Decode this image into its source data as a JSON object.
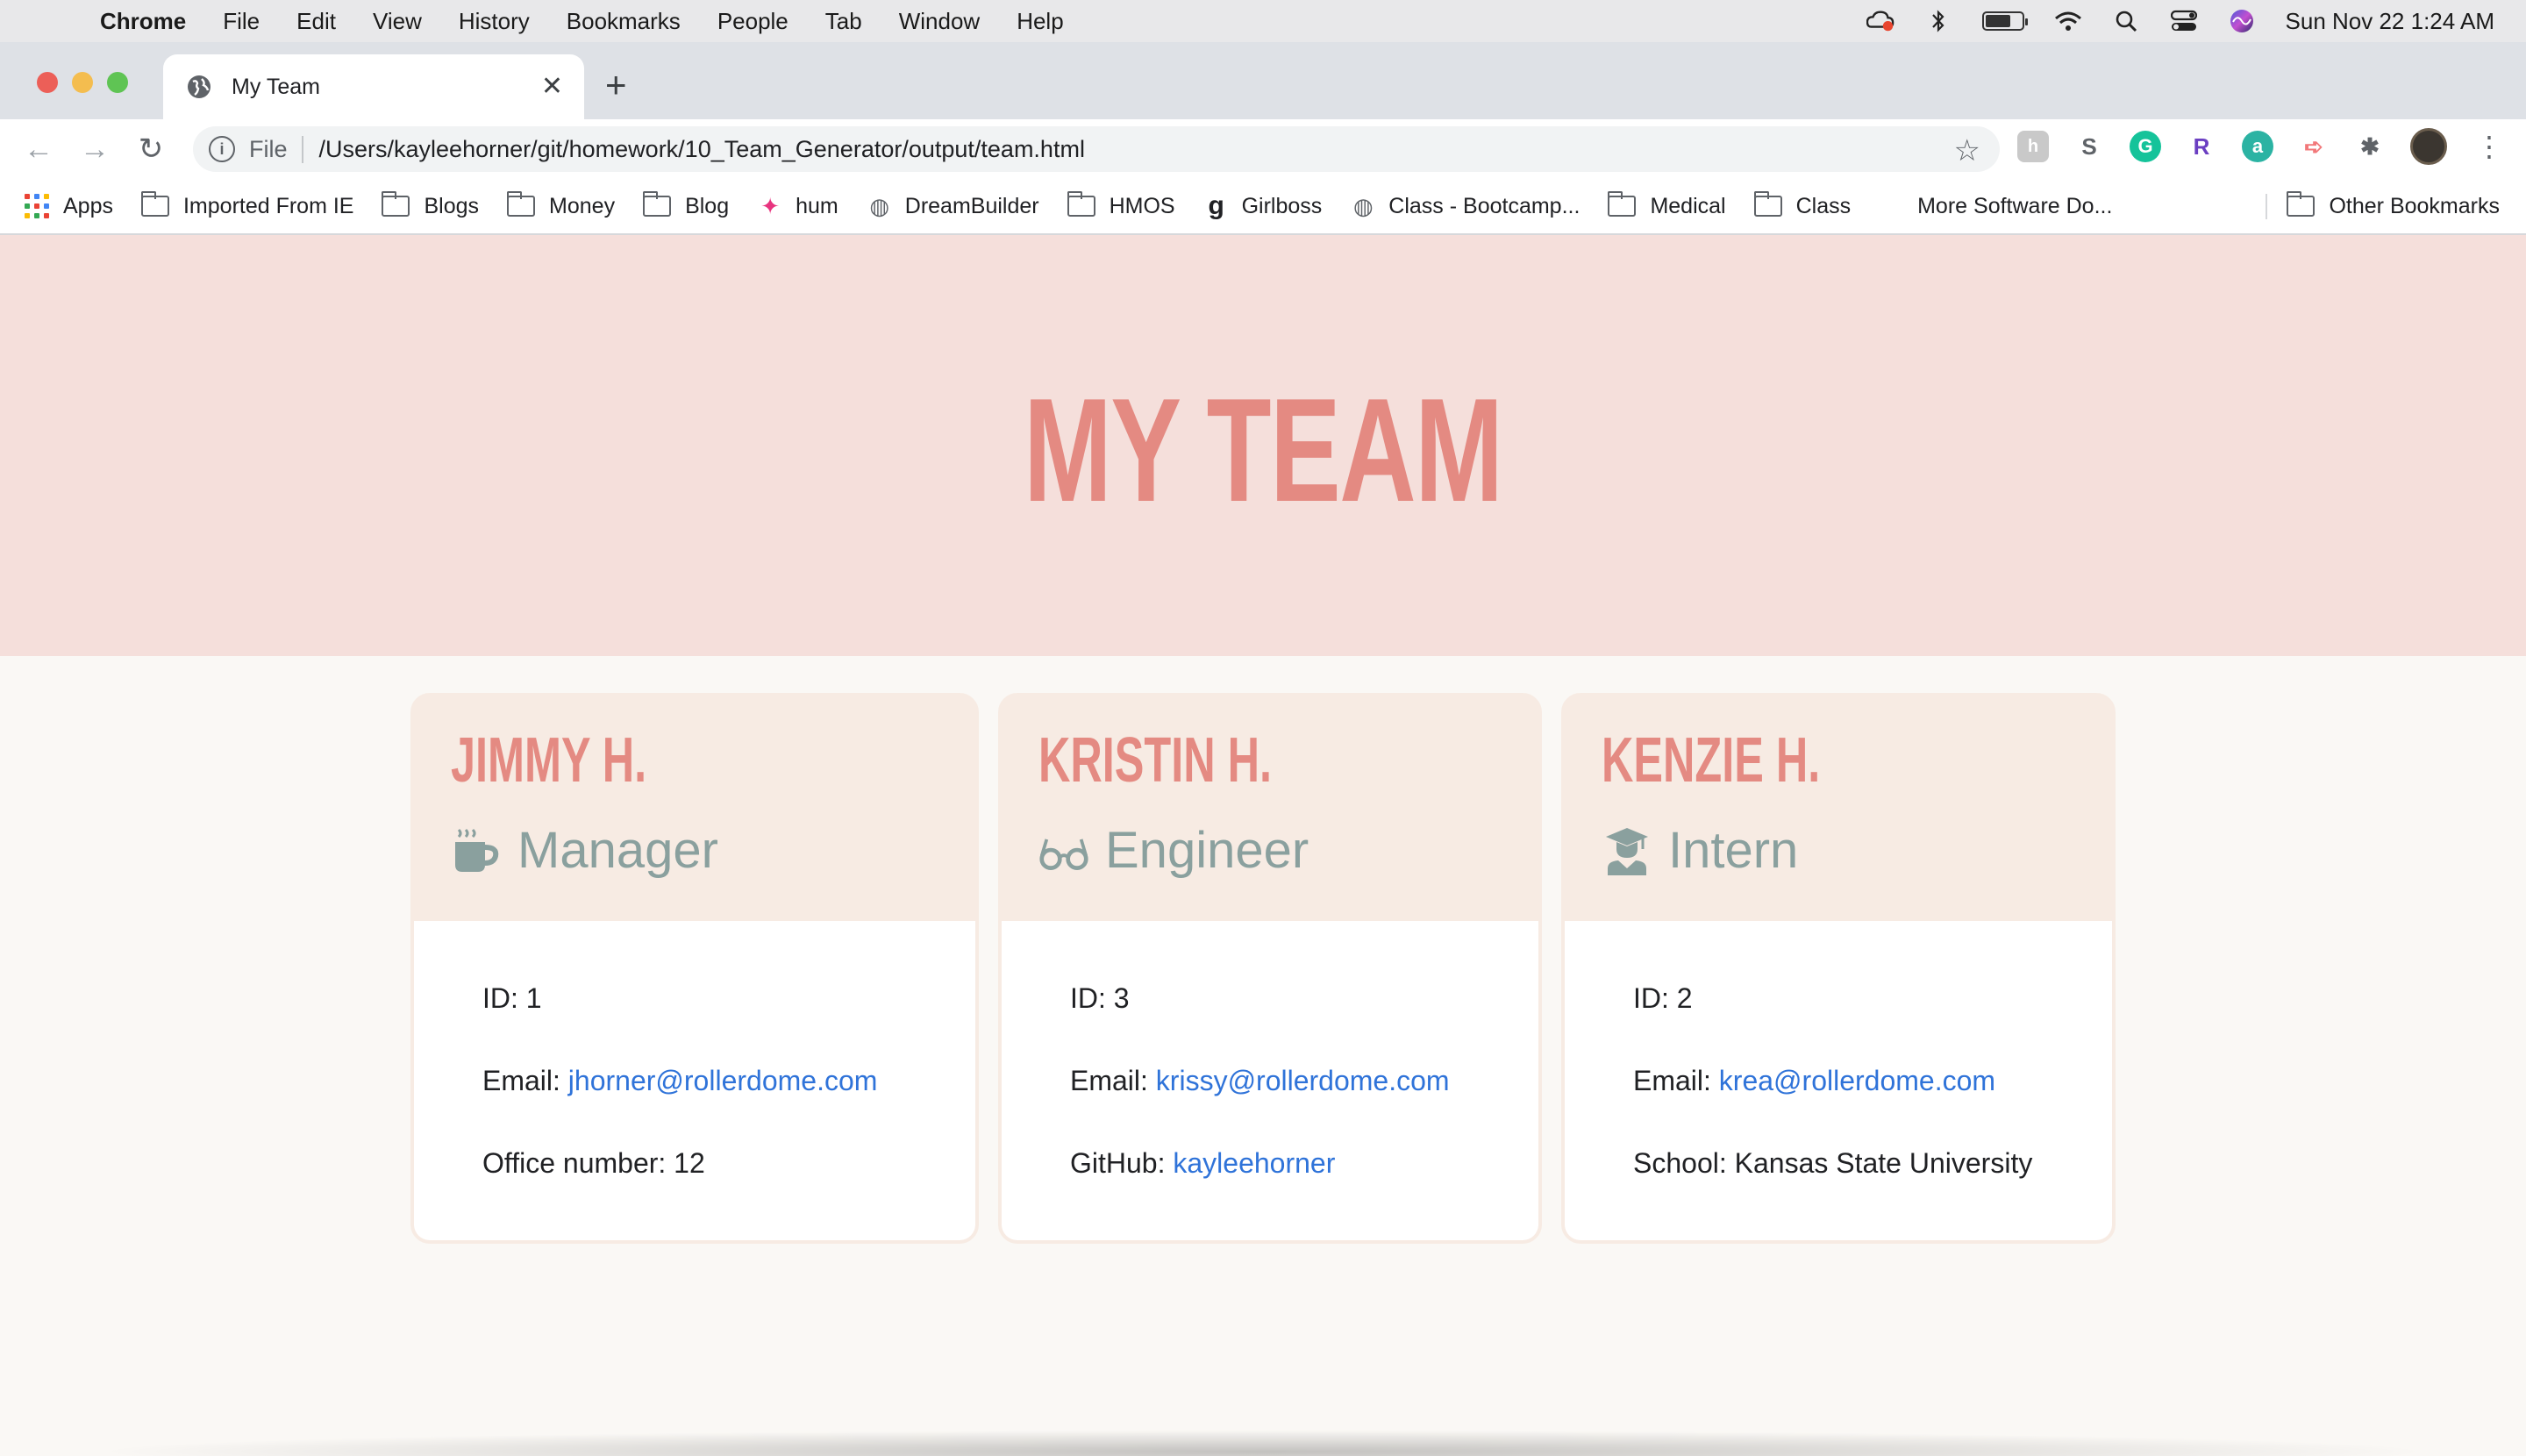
{
  "menubar": {
    "app": "Chrome",
    "items": [
      "File",
      "Edit",
      "View",
      "History",
      "Bookmarks",
      "People",
      "Tab",
      "Window",
      "Help"
    ],
    "datetime": "Sun Nov 22  1:24 AM"
  },
  "tab": {
    "title": "My Team"
  },
  "omnibox": {
    "scheme": "File",
    "url": "/Users/kayleehorner/git/homework/10_Team_Generator/output/team.html"
  },
  "bookmarks": {
    "apps": "Apps",
    "items": [
      "Imported From IE",
      "Blogs",
      "Money",
      "Blog",
      "hum",
      "DreamBuilder",
      "HMOS",
      "Girlboss",
      "Class - Bootcamp...",
      "Medical",
      "Class",
      "More Software Do..."
    ],
    "other": "Other Bookmarks"
  },
  "page": {
    "title": "MY TEAM",
    "cards": [
      {
        "name": "JIMMY H.",
        "role": "Manager",
        "role_icon": "coffee-mug-icon",
        "id_label": "ID: 1",
        "email_prefix": "Email: ",
        "email": "jhorner@rollerdome.com",
        "extra_prefix": "Office number: 12",
        "extra_link": ""
      },
      {
        "name": "KRISTIN H.",
        "role": "Engineer",
        "role_icon": "glasses-icon",
        "id_label": "ID: 3",
        "email_prefix": "Email: ",
        "email": "krissy@rollerdome.com",
        "extra_prefix": "GitHub: ",
        "extra_link": "kayleehorner"
      },
      {
        "name": "KENZIE H.",
        "role": "Intern",
        "role_icon": "graduate-icon",
        "id_label": "ID: 2",
        "email_prefix": "Email: ",
        "email": "krea@rollerdome.com",
        "extra_prefix": "School: Kansas State University",
        "extra_link": ""
      }
    ]
  },
  "colors": {
    "hero_bg": "#f5dfdb",
    "accent": "#e48a82",
    "role": "#8aa09e",
    "link": "#2f73d9",
    "card_head": "#f7ebe3"
  }
}
